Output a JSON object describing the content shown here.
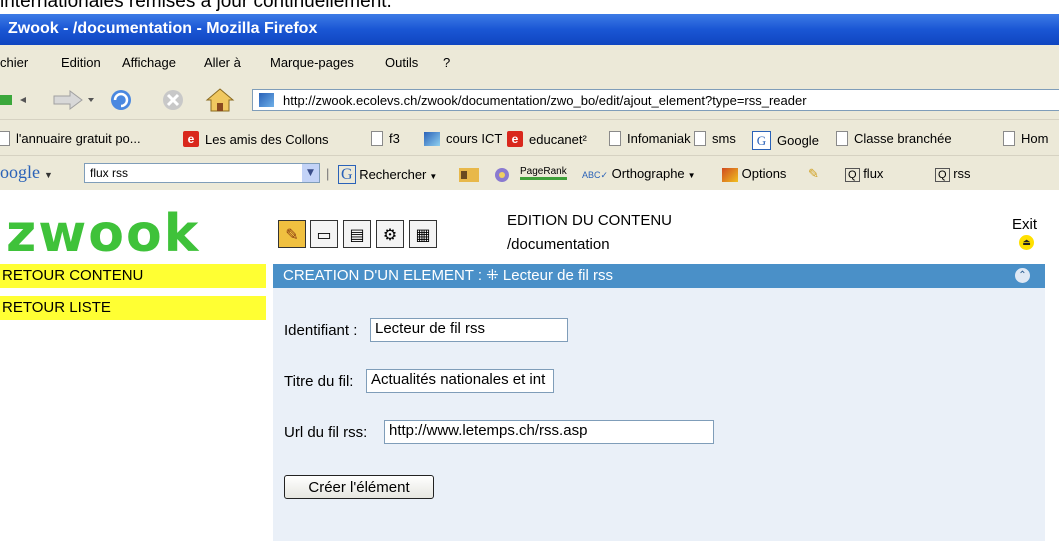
{
  "overlay_text": "internationales remises à jour continuellement.",
  "window": {
    "title": "Zwook - /documentation - Mozilla Firefox"
  },
  "menu": [
    {
      "label": "chier"
    },
    {
      "label": "Edition"
    },
    {
      "label": "Affichage"
    },
    {
      "label": "Aller à"
    },
    {
      "label": "Marque-pages"
    },
    {
      "label": "Outils"
    },
    {
      "label": "?"
    }
  ],
  "navigation": {
    "url": "http://zwook.ecolevs.ch/zwook/documentation/zwo_bo/edit/ajout_element?type=rss_reader"
  },
  "bookmarks": [
    {
      "label": "l'annuaire gratuit po...",
      "icon": "doc-icon"
    },
    {
      "label": "Les amis des Collons",
      "icon": "e-icon"
    },
    {
      "label": "f3",
      "icon": "doc-icon"
    },
    {
      "label": "cours ICT",
      "icon": "ict-icon"
    },
    {
      "label": "educanet²",
      "icon": "e-icon"
    },
    {
      "label": "Infomaniak",
      "icon": "doc-icon"
    },
    {
      "label": "sms",
      "icon": "doc-icon"
    },
    {
      "label": "Google",
      "icon": "google-icon"
    },
    {
      "label": "Classe branchée",
      "icon": "doc-icon"
    },
    {
      "label": "Hom",
      "icon": "doc-icon"
    }
  ],
  "google_toolbar": {
    "brand": "oogle",
    "search_value": "flux rss",
    "search_label": "Rechercher",
    "pagerank_label": "PageRank",
    "spell_label": "Orthographe",
    "options_label": "Options",
    "hl1": "flux",
    "hl2": "rss"
  },
  "zwook": {
    "logo": "zwook",
    "edit_title": "EDITION DU CONTENU",
    "edit_path": "/documentation",
    "exit_label": "Exit",
    "side_buttons": [
      "RETOUR CONTENU",
      "RETOUR LISTE"
    ],
    "panel_title": "CREATION D'UN ELEMENT :  ⁜  Lecteur de fil rss",
    "form": {
      "identifiant_label": "Identifiant :",
      "identifiant_value": "Lecteur de fil rss",
      "titre_label": "Titre du fil:",
      "titre_value": "Actualités nationales et int",
      "url_label": "Url du fil rss:",
      "url_value": "http://www.letemps.ch/rss.asp",
      "submit_label": "Créer l'élément"
    }
  }
}
